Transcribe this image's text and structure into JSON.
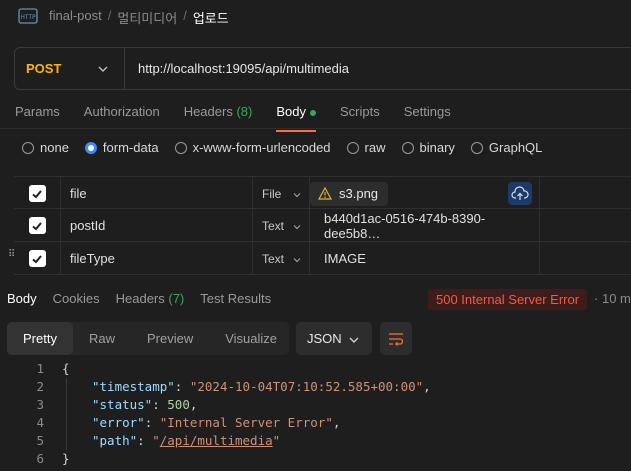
{
  "breadcrumb": {
    "collection": "final-post",
    "folder": "멀티미디어",
    "request": "업로드",
    "separator": "/"
  },
  "request": {
    "method": "POST",
    "url": "http://localhost:19095/api/multimedia"
  },
  "request_tabs": [
    {
      "label": "Params"
    },
    {
      "label": "Authorization"
    },
    {
      "label": "Headers",
      "count": "(8)"
    },
    {
      "label": "Body"
    },
    {
      "label": "Scripts"
    },
    {
      "label": "Settings"
    }
  ],
  "body_types": [
    "none",
    "form-data",
    "x-www-form-urlencoded",
    "raw",
    "binary",
    "GraphQL"
  ],
  "selected_body_type": "form-data",
  "form_rows": [
    {
      "key": "file",
      "type": "File",
      "value": "s3.png"
    },
    {
      "key": "postId",
      "type": "Text",
      "value": "b440d1ac-0516-474b-8390-dee5b8…"
    },
    {
      "key": "fileType",
      "type": "Text",
      "value": "IMAGE"
    }
  ],
  "response_tabs": [
    {
      "label": "Body"
    },
    {
      "label": "Cookies"
    },
    {
      "label": "Headers",
      "count": "(7)"
    },
    {
      "label": "Test Results"
    }
  ],
  "status": {
    "text": "500 Internal Server Error",
    "color": "#ef5b4c"
  },
  "response_time": "10 m",
  "view_modes": [
    "Pretty",
    "Raw",
    "Preview",
    "Visualize"
  ],
  "format": "JSON",
  "json_lines": {
    "l1": "{",
    "k_timestamp": "\"timestamp\"",
    "v_timestamp": "\"2024-10-04T07:10:52.585+00:00\"",
    "k_status": "\"status\"",
    "v_status": "500",
    "k_error": "\"error\"",
    "v_error": "\"Internal Server Error\"",
    "k_path": "\"path\"",
    "v_path": "/api/multimedia",
    "l6": "}"
  },
  "line_numbers": [
    "1",
    "2",
    "3",
    "4",
    "5",
    "6"
  ],
  "colors": {
    "accent": "#ff6c37",
    "method": "#ffb400",
    "radio_selected": "#3d8bfd",
    "headers_count": "#3ba55c"
  },
  "icons": [
    "http-icon",
    "chevron-down-icon",
    "check-icon",
    "warning-icon",
    "cloud-upload-icon",
    "drag-handle-icon",
    "wrap-lines-icon"
  ]
}
